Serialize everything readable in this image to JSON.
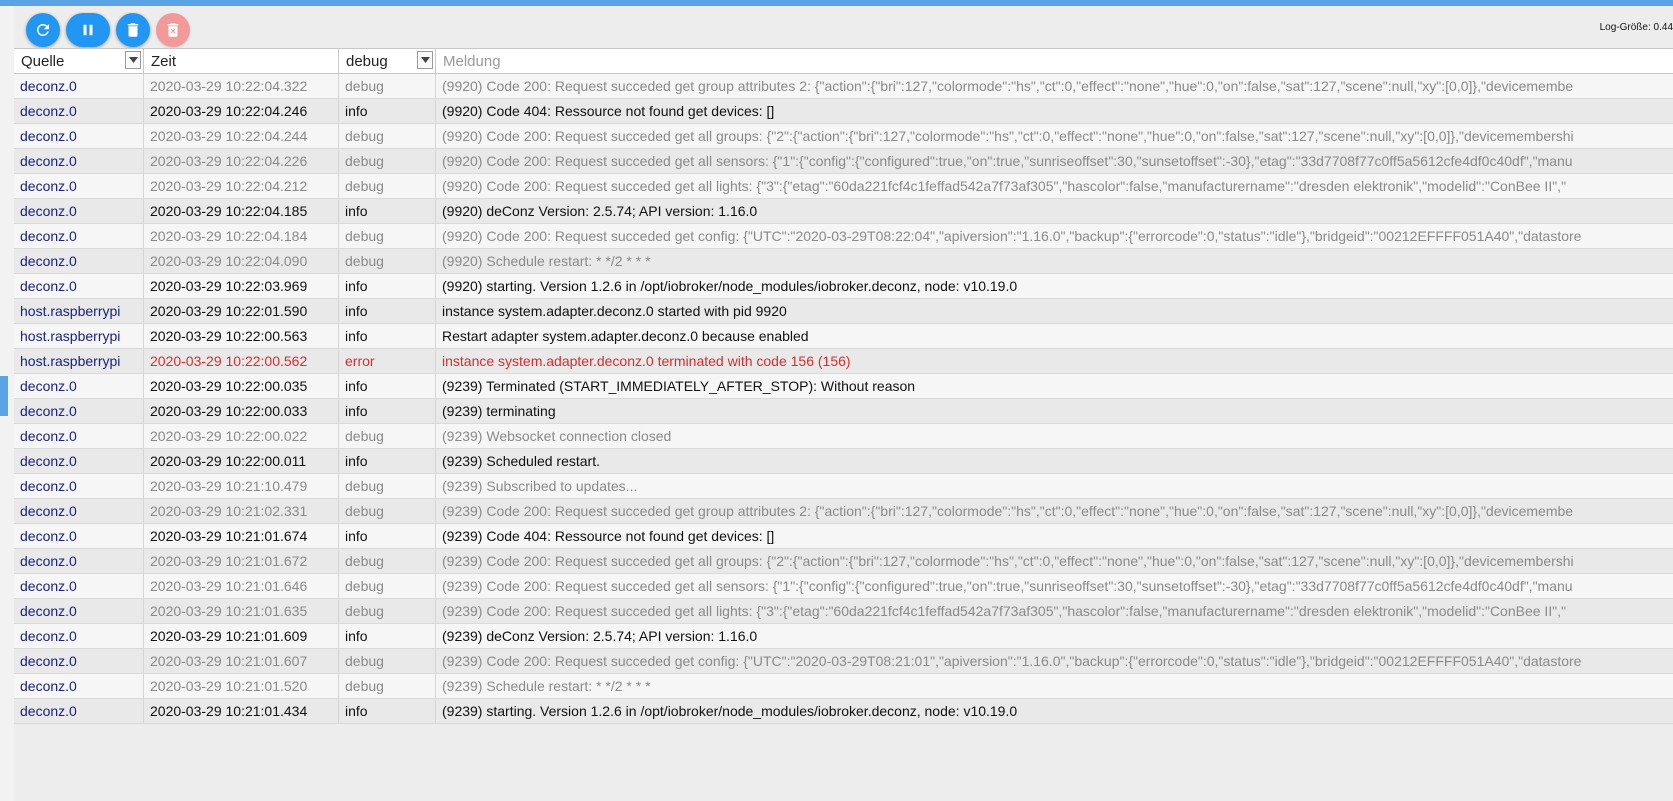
{
  "toolbar": {
    "log_size": "Log-Größe: 0.44"
  },
  "header": {
    "source": "Quelle",
    "time": "Zeit",
    "level": "debug",
    "message_placeholder": "Meldung"
  },
  "colors": {
    "accent": "#2196f3",
    "error": "#d32f2f",
    "source": "#1a237e"
  },
  "rows": [
    {
      "src": "deconz.0",
      "time": "2020-03-29 10:22:04.322",
      "lvl": "debug",
      "msg": "(9920) Code 200: Request succeded get group attributes 2: {\"action\":{\"bri\":127,\"colormode\":\"hs\",\"ct\":0,\"effect\":\"none\",\"hue\":0,\"on\":false,\"sat\":127,\"scene\":null,\"xy\":[0,0]},\"devicemembe"
    },
    {
      "src": "deconz.0",
      "time": "2020-03-29 10:22:04.246",
      "lvl": "info",
      "msg": "(9920) Code 404: Ressource not found get devices: []"
    },
    {
      "src": "deconz.0",
      "time": "2020-03-29 10:22:04.244",
      "lvl": "debug",
      "msg": "(9920) Code 200: Request succeded get all groups: {\"2\":{\"action\":{\"bri\":127,\"colormode\":\"hs\",\"ct\":0,\"effect\":\"none\",\"hue\":0,\"on\":false,\"sat\":127,\"scene\":null,\"xy\":[0,0]},\"devicemembershi"
    },
    {
      "src": "deconz.0",
      "time": "2020-03-29 10:22:04.226",
      "lvl": "debug",
      "msg": "(9920) Code 200: Request succeded get all sensors: {\"1\":{\"config\":{\"configured\":true,\"on\":true,\"sunriseoffset\":30,\"sunsetoffset\":-30},\"etag\":\"33d7708f77c0ff5a5612cfe4df0c40df\",\"manu"
    },
    {
      "src": "deconz.0",
      "time": "2020-03-29 10:22:04.212",
      "lvl": "debug",
      "msg": "(9920) Code 200: Request succeded get all lights: {\"3\":{\"etag\":\"60da221fcf4c1feffad542a7f73af305\",\"hascolor\":false,\"manufacturername\":\"dresden elektronik\",\"modelid\":\"ConBee II\",\""
    },
    {
      "src": "deconz.0",
      "time": "2020-03-29 10:22:04.185",
      "lvl": "info",
      "msg": "(9920) deConz Version: 2.5.74; API version: 1.16.0"
    },
    {
      "src": "deconz.0",
      "time": "2020-03-29 10:22:04.184",
      "lvl": "debug",
      "msg": "(9920) Code 200: Request succeded get config: {\"UTC\":\"2020-03-29T08:22:04\",\"apiversion\":\"1.16.0\",\"backup\":{\"errorcode\":0,\"status\":\"idle\"},\"bridgeid\":\"00212EFFFF051A40\",\"datastore"
    },
    {
      "src": "deconz.0",
      "time": "2020-03-29 10:22:04.090",
      "lvl": "debug",
      "msg": "(9920) Schedule restart: * */2 * * *"
    },
    {
      "src": "deconz.0",
      "time": "2020-03-29 10:22:03.969",
      "lvl": "info",
      "msg": "(9920) starting. Version 1.2.6 in /opt/iobroker/node_modules/iobroker.deconz, node: v10.19.0"
    },
    {
      "src": "host.raspberrypi",
      "time": "2020-03-29 10:22:01.590",
      "lvl": "info",
      "msg": "instance system.adapter.deconz.0 started with pid 9920"
    },
    {
      "src": "host.raspberrypi",
      "time": "2020-03-29 10:22:00.563",
      "lvl": "info",
      "msg": "Restart adapter system.adapter.deconz.0 because enabled"
    },
    {
      "src": "host.raspberrypi",
      "time": "2020-03-29 10:22:00.562",
      "lvl": "error",
      "msg": "instance system.adapter.deconz.0 terminated with code 156 (156)"
    },
    {
      "src": "deconz.0",
      "time": "2020-03-29 10:22:00.035",
      "lvl": "info",
      "msg": "(9239) Terminated (START_IMMEDIATELY_AFTER_STOP): Without reason"
    },
    {
      "src": "deconz.0",
      "time": "2020-03-29 10:22:00.033",
      "lvl": "info",
      "msg": "(9239) terminating"
    },
    {
      "src": "deconz.0",
      "time": "2020-03-29 10:22:00.022",
      "lvl": "debug",
      "msg": "(9239) Websocket connection closed"
    },
    {
      "src": "deconz.0",
      "time": "2020-03-29 10:22:00.011",
      "lvl": "info",
      "msg": "(9239) Scheduled restart."
    },
    {
      "src": "deconz.0",
      "time": "2020-03-29 10:21:10.479",
      "lvl": "debug",
      "msg": "(9239) Subscribed to updates..."
    },
    {
      "src": "deconz.0",
      "time": "2020-03-29 10:21:02.331",
      "lvl": "debug",
      "msg": "(9239) Code 200: Request succeded get group attributes 2: {\"action\":{\"bri\":127,\"colormode\":\"hs\",\"ct\":0,\"effect\":\"none\",\"hue\":0,\"on\":false,\"sat\":127,\"scene\":null,\"xy\":[0,0]},\"devicemembe"
    },
    {
      "src": "deconz.0",
      "time": "2020-03-29 10:21:01.674",
      "lvl": "info",
      "msg": "(9239) Code 404: Ressource not found get devices: []"
    },
    {
      "src": "deconz.0",
      "time": "2020-03-29 10:21:01.672",
      "lvl": "debug",
      "msg": "(9239) Code 200: Request succeded get all groups: {\"2\":{\"action\":{\"bri\":127,\"colormode\":\"hs\",\"ct\":0,\"effect\":\"none\",\"hue\":0,\"on\":false,\"sat\":127,\"scene\":null,\"xy\":[0,0]},\"devicemembershi"
    },
    {
      "src": "deconz.0",
      "time": "2020-03-29 10:21:01.646",
      "lvl": "debug",
      "msg": "(9239) Code 200: Request succeded get all sensors: {\"1\":{\"config\":{\"configured\":true,\"on\":true,\"sunriseoffset\":30,\"sunsetoffset\":-30},\"etag\":\"33d7708f77c0ff5a5612cfe4df0c40df\",\"manu"
    },
    {
      "src": "deconz.0",
      "time": "2020-03-29 10:21:01.635",
      "lvl": "debug",
      "msg": "(9239) Code 200: Request succeded get all lights: {\"3\":{\"etag\":\"60da221fcf4c1feffad542a7f73af305\",\"hascolor\":false,\"manufacturername\":\"dresden elektronik\",\"modelid\":\"ConBee II\",\""
    },
    {
      "src": "deconz.0",
      "time": "2020-03-29 10:21:01.609",
      "lvl": "info",
      "msg": "(9239) deConz Version: 2.5.74; API version: 1.16.0"
    },
    {
      "src": "deconz.0",
      "time": "2020-03-29 10:21:01.607",
      "lvl": "debug",
      "msg": "(9239) Code 200: Request succeded get config: {\"UTC\":\"2020-03-29T08:21:01\",\"apiversion\":\"1.16.0\",\"backup\":{\"errorcode\":0,\"status\":\"idle\"},\"bridgeid\":\"00212EFFFF051A40\",\"datastore"
    },
    {
      "src": "deconz.0",
      "time": "2020-03-29 10:21:01.520",
      "lvl": "debug",
      "msg": "(9239) Schedule restart: * */2 * * *"
    },
    {
      "src": "deconz.0",
      "time": "2020-03-29 10:21:01.434",
      "lvl": "info",
      "msg": "(9239) starting. Version 1.2.6 in /opt/iobroker/node_modules/iobroker.deconz, node: v10.19.0"
    }
  ]
}
